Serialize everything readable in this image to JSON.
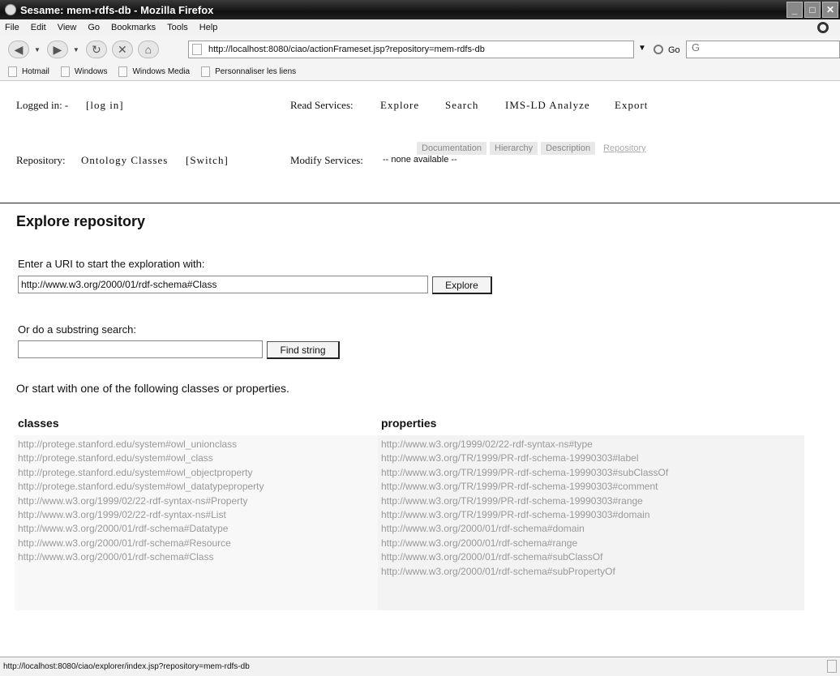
{
  "window": {
    "title": "Sesame: mem-rdfs-db - Mozilla Firefox"
  },
  "menu": [
    "File",
    "Edit",
    "View",
    "Go",
    "Bookmarks",
    "Tools",
    "Help"
  ],
  "toolbar": {
    "url": "http://localhost:8080/ciao/actionFrameset.jsp?repository=mem-rdfs-db",
    "go_label": "Go",
    "search_value": "G"
  },
  "bookmarks": [
    "Hotmail",
    "Windows",
    "Windows Media",
    "Personnaliser les liens"
  ],
  "header": {
    "logged_in_label": "Logged in: -",
    "login_link": "[log in]",
    "repository_label": "Repository:",
    "repository_name": "Ontology Classes",
    "switch_link": "[Switch]",
    "read_services_label": "Read Services:",
    "read_services": [
      "Explore",
      "Search",
      "IMS-LD Analyze",
      "Export"
    ],
    "modify_services_label": "Modify Services:",
    "modify_services_value": "-- none available --",
    "subtabs": [
      "Documentation",
      "Hierarchy",
      "Description",
      "Repository"
    ]
  },
  "main": {
    "title": "Explore repository",
    "uri_prompt": "Enter a URI to start the exploration with:",
    "uri_value": "http://www.w3.org/2000/01/rdf-schema#Class",
    "explore_button": "Explore",
    "search_prompt": "Or do a substring search:",
    "search_value": "",
    "find_button": "Find string",
    "start_prompt": "Or start with one of the following classes or properties.",
    "classes_heading": "classes",
    "properties_heading": "properties",
    "classes": [
      "http://protege.stanford.edu/system#owl_unionclass",
      "http://protege.stanford.edu/system#owl_class",
      "http://protege.stanford.edu/system#owl_objectproperty",
      "http://protege.stanford.edu/system#owl_datatypeproperty",
      "http://www.w3.org/1999/02/22-rdf-syntax-ns#Property",
      "http://www.w3.org/1999/02/22-rdf-syntax-ns#List",
      "http://www.w3.org/2000/01/rdf-schema#Datatype",
      "http://www.w3.org/2000/01/rdf-schema#Resource",
      "http://www.w3.org/2000/01/rdf-schema#Class"
    ],
    "properties": [
      "http://www.w3.org/1999/02/22-rdf-syntax-ns#type",
      "http://www.w3.org/TR/1999/PR-rdf-schema-19990303#label",
      "http://www.w3.org/TR/1999/PR-rdf-schema-19990303#subClassOf",
      "http://www.w3.org/TR/1999/PR-rdf-schema-19990303#comment",
      "http://www.w3.org/TR/1999/PR-rdf-schema-19990303#range",
      "http://www.w3.org/TR/1999/PR-rdf-schema-19990303#domain",
      "http://www.w3.org/2000/01/rdf-schema#domain",
      "http://www.w3.org/2000/01/rdf-schema#range",
      "http://www.w3.org/2000/01/rdf-schema#subClassOf",
      "http://www.w3.org/2000/01/rdf-schema#subPropertyOf"
    ]
  },
  "status": {
    "text": "http://localhost:8080/ciao/explorer/index.jsp?repository=mem-rdfs-db"
  }
}
